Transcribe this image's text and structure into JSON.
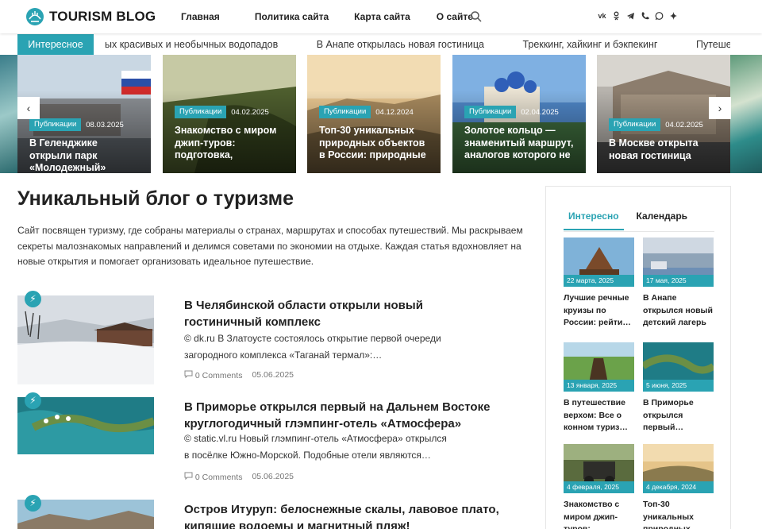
{
  "brand": {
    "name": "TOURISM BLOG"
  },
  "nav": [
    {
      "label": "Главная"
    },
    {
      "label": "Политика сайта"
    },
    {
      "label": "Карта сайта"
    },
    {
      "label": "О сайте"
    }
  ],
  "socials": [
    "vk-icon",
    "ok-icon",
    "telegram-icon",
    "phone-icon",
    "whatsapp-icon",
    "dzen-icon"
  ],
  "ticker": {
    "label": "Интересное",
    "items": [
      "ых красивых и необычных водопадов",
      "В Анапе открылась новая гостиница",
      "Треккинг, хайкинг и бэкпекинг",
      "Путешествие с"
    ]
  },
  "slider": [
    {
      "badge": "Публикации",
      "date": "08.03.2025",
      "title": "В Геленджике открыли парк «Молодежный»"
    },
    {
      "badge": "Публикации",
      "date": "04.02.2025",
      "title": "Знакомство с миром джип-туров: подготовка,"
    },
    {
      "badge": "Публикации",
      "date": "04.12.2024",
      "title": "Топ-30 уникальных природных объектов в России: природные"
    },
    {
      "badge": "Публикации",
      "date": "02.04.2025",
      "title": "Золотое кольцо — знаменитый маршрут, аналогов которого не"
    },
    {
      "badge": "Публикации",
      "date": "04.02.2025",
      "title": "В Москве открыта новая гостиница"
    }
  ],
  "main": {
    "title": "Уникальный блог о туризме",
    "intro": "Сайт посвящен туризму, где собраны материалы о странах, маршрутах и способах путешествий. Мы раскрываем секреты малознакомых направлений и делимся советами по экономии на отдыхе. Каждая статья вдохновляет на новые открытия и помогает организовать идеальное путешествие."
  },
  "posts": [
    {
      "title": "В Челябинской области открыли новый гостиничный комплекс",
      "excerpt": " © dk.ru В Златоусте состоялось открытие первой очереди загородного комплекса «Таганай термал»:…",
      "comments": "0 Comments",
      "date": "05.06.2025"
    },
    {
      "title": "В Приморье открылся первый на Дальнем Востоке круглогодичный глэмпинг-отель «Атмосфера»",
      "excerpt": " © static.vl.ru Новый глэмпинг-отель «Атмосфера» открылся в посёлке Южно-Морской. Подобные отели являются…",
      "comments": "0 Comments",
      "date": "05.06.2025"
    },
    {
      "title": "Остров Итуруп: белоснежные скалы, лавовое плато, кипящие водоемы и магнитный пляж!",
      "excerpt": "",
      "comments": "",
      "date": ""
    }
  ],
  "sidebar": {
    "tabs": [
      {
        "label": "Интересно"
      },
      {
        "label": "Календарь"
      }
    ],
    "cards": [
      {
        "date": "22 марта, 2025",
        "title": "Лучшие речные круизы по России: рейти…"
      },
      {
        "date": "17 мая, 2025",
        "title": "В Анапе открылся новый детский лагерь"
      },
      {
        "date": "13 января, 2025",
        "title": "В путешествие верхом: Все о конном туриз…"
      },
      {
        "date": "5 июня, 2025",
        "title": "В Приморье открылся первый…"
      },
      {
        "date": "4 февраля, 2025",
        "title": "Знакомство с миром джип-туров:"
      },
      {
        "date": "4 декабря, 2024",
        "title": "Топ-30 уникальных природных"
      }
    ]
  },
  "colors": {
    "accent": "#2aa3b3",
    "text": "#222222"
  }
}
